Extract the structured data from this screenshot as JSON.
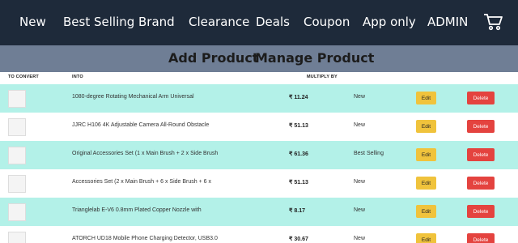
{
  "nav": {
    "items": [
      "New",
      "Best Selling",
      "Brand",
      "Clearance",
      "Deals",
      "Coupon",
      "App only",
      "ADMIN"
    ],
    "cart_icon": "cart-icon"
  },
  "subnav": {
    "add": "Add Product",
    "manage": "Manage Product"
  },
  "table": {
    "headers": {
      "col1": "TO CONVERT",
      "col2": "INTO",
      "col3": "MULTIPLY BY"
    },
    "rows": [
      {
        "name": "1080-degree Rotating Mechanical Arm Universal",
        "price": "₹ 11.24",
        "tag": "New",
        "edit": "Edit",
        "delete": "Delete"
      },
      {
        "name": "JJRC H106 4K Adjustable Camera All-Round Obstacle",
        "price": "₹ 51.13",
        "tag": "New",
        "edit": "Edit",
        "delete": "Delete"
      },
      {
        "name": "Original Accessories Set (1 x Main Brush + 2 x Side Brush",
        "price": "₹ 61.36",
        "tag": "Best Selling",
        "edit": "Edit",
        "delete": "Delete"
      },
      {
        "name": "Accessories Set (2 x Main Brush + 6 x Side Brush + 6 x",
        "price": "₹ 51.13",
        "tag": "New",
        "edit": "Edit",
        "delete": "Delete"
      },
      {
        "name": "Trianglelab E-V6 0.8mm Plated Copper Nozzle with",
        "price": "₹ 8.17",
        "tag": "New",
        "edit": "Edit",
        "delete": "Delete"
      },
      {
        "name": "ATORCH UD18 Mobile Phone Charging Detector, USB3.0",
        "price": "₹ 30.67",
        "tag": "New",
        "edit": "Edit",
        "delete": "Delete"
      }
    ]
  },
  "colors": {
    "nav_bg": "#1e2a3a",
    "subbar_bg": "#6f7e95",
    "row_teal": "#b3f1e8",
    "edit_btn": "#f0c33c",
    "delete_btn": "#e4433f"
  }
}
